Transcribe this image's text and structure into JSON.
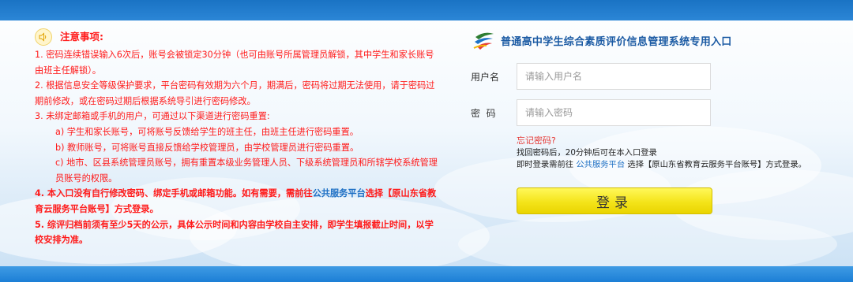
{
  "notice": {
    "title": "注意事项:",
    "item1": "1. 密码连续错误输入6次后，账号会被锁定30分钟（也可由账号所属管理员解锁，其中学生和家长账号由班主任解锁）。",
    "item2": "2. 根据信息安全等级保护要求，平台密码有效期为六个月，期满后，密码将过期无法使用，请于密码过期前修改，或在密码过期后根据系统导引进行密码修改。",
    "item3": "3. 未绑定邮箱或手机的用户，可通过以下渠道进行密码重置:",
    "item3a": "a) 学生和家长账号，可将账号反馈给学生的班主任，由班主任进行密码重置。",
    "item3b": "b) 教师账号，可将账号直接反馈给学校管理员，由学校管理员进行密码重置。",
    "item3c": "c) 地市、区县系统管理员账号，拥有重置本级业务管理人员、下级系统管理员和所辖学校系统管理员账号的权限。",
    "item4_pre": "4. 本入口没有自行修改密码、绑定手机或邮箱功能。如有需要，需前往",
    "item4_link": "公共服务平台",
    "item4_post": "选择【原山东省教育云服务平台账号】方式登录。",
    "item5": "5. 综评归档前须有至少5天的公示，具体公示时间和内容由学校自主安排，即学生填报截止时间，以学校安排为准。"
  },
  "login": {
    "title": "普通高中学生综合素质评价信息管理系统专用入口",
    "username_label": "用户名",
    "username_placeholder": "请输入用户名",
    "password_label": "密  码",
    "password_placeholder": "请输入密码",
    "forgot": "忘记密码?",
    "tip1": "找回密码后，20分钟后可在本入口登录",
    "tip2_pre": "即时登录需前往",
    "tip2_link": "公共服务平台",
    "tip2_post": "选择【原山东省教育云服务平台账号】方式登录。",
    "button": "登录"
  },
  "colors": {
    "header": "#1a73c4",
    "notice_text": "#ff1a1a",
    "title_text": "#1b5aa3",
    "button": "#f4e41a"
  },
  "icons": [
    "speaker-icon",
    "logo-icon"
  ]
}
